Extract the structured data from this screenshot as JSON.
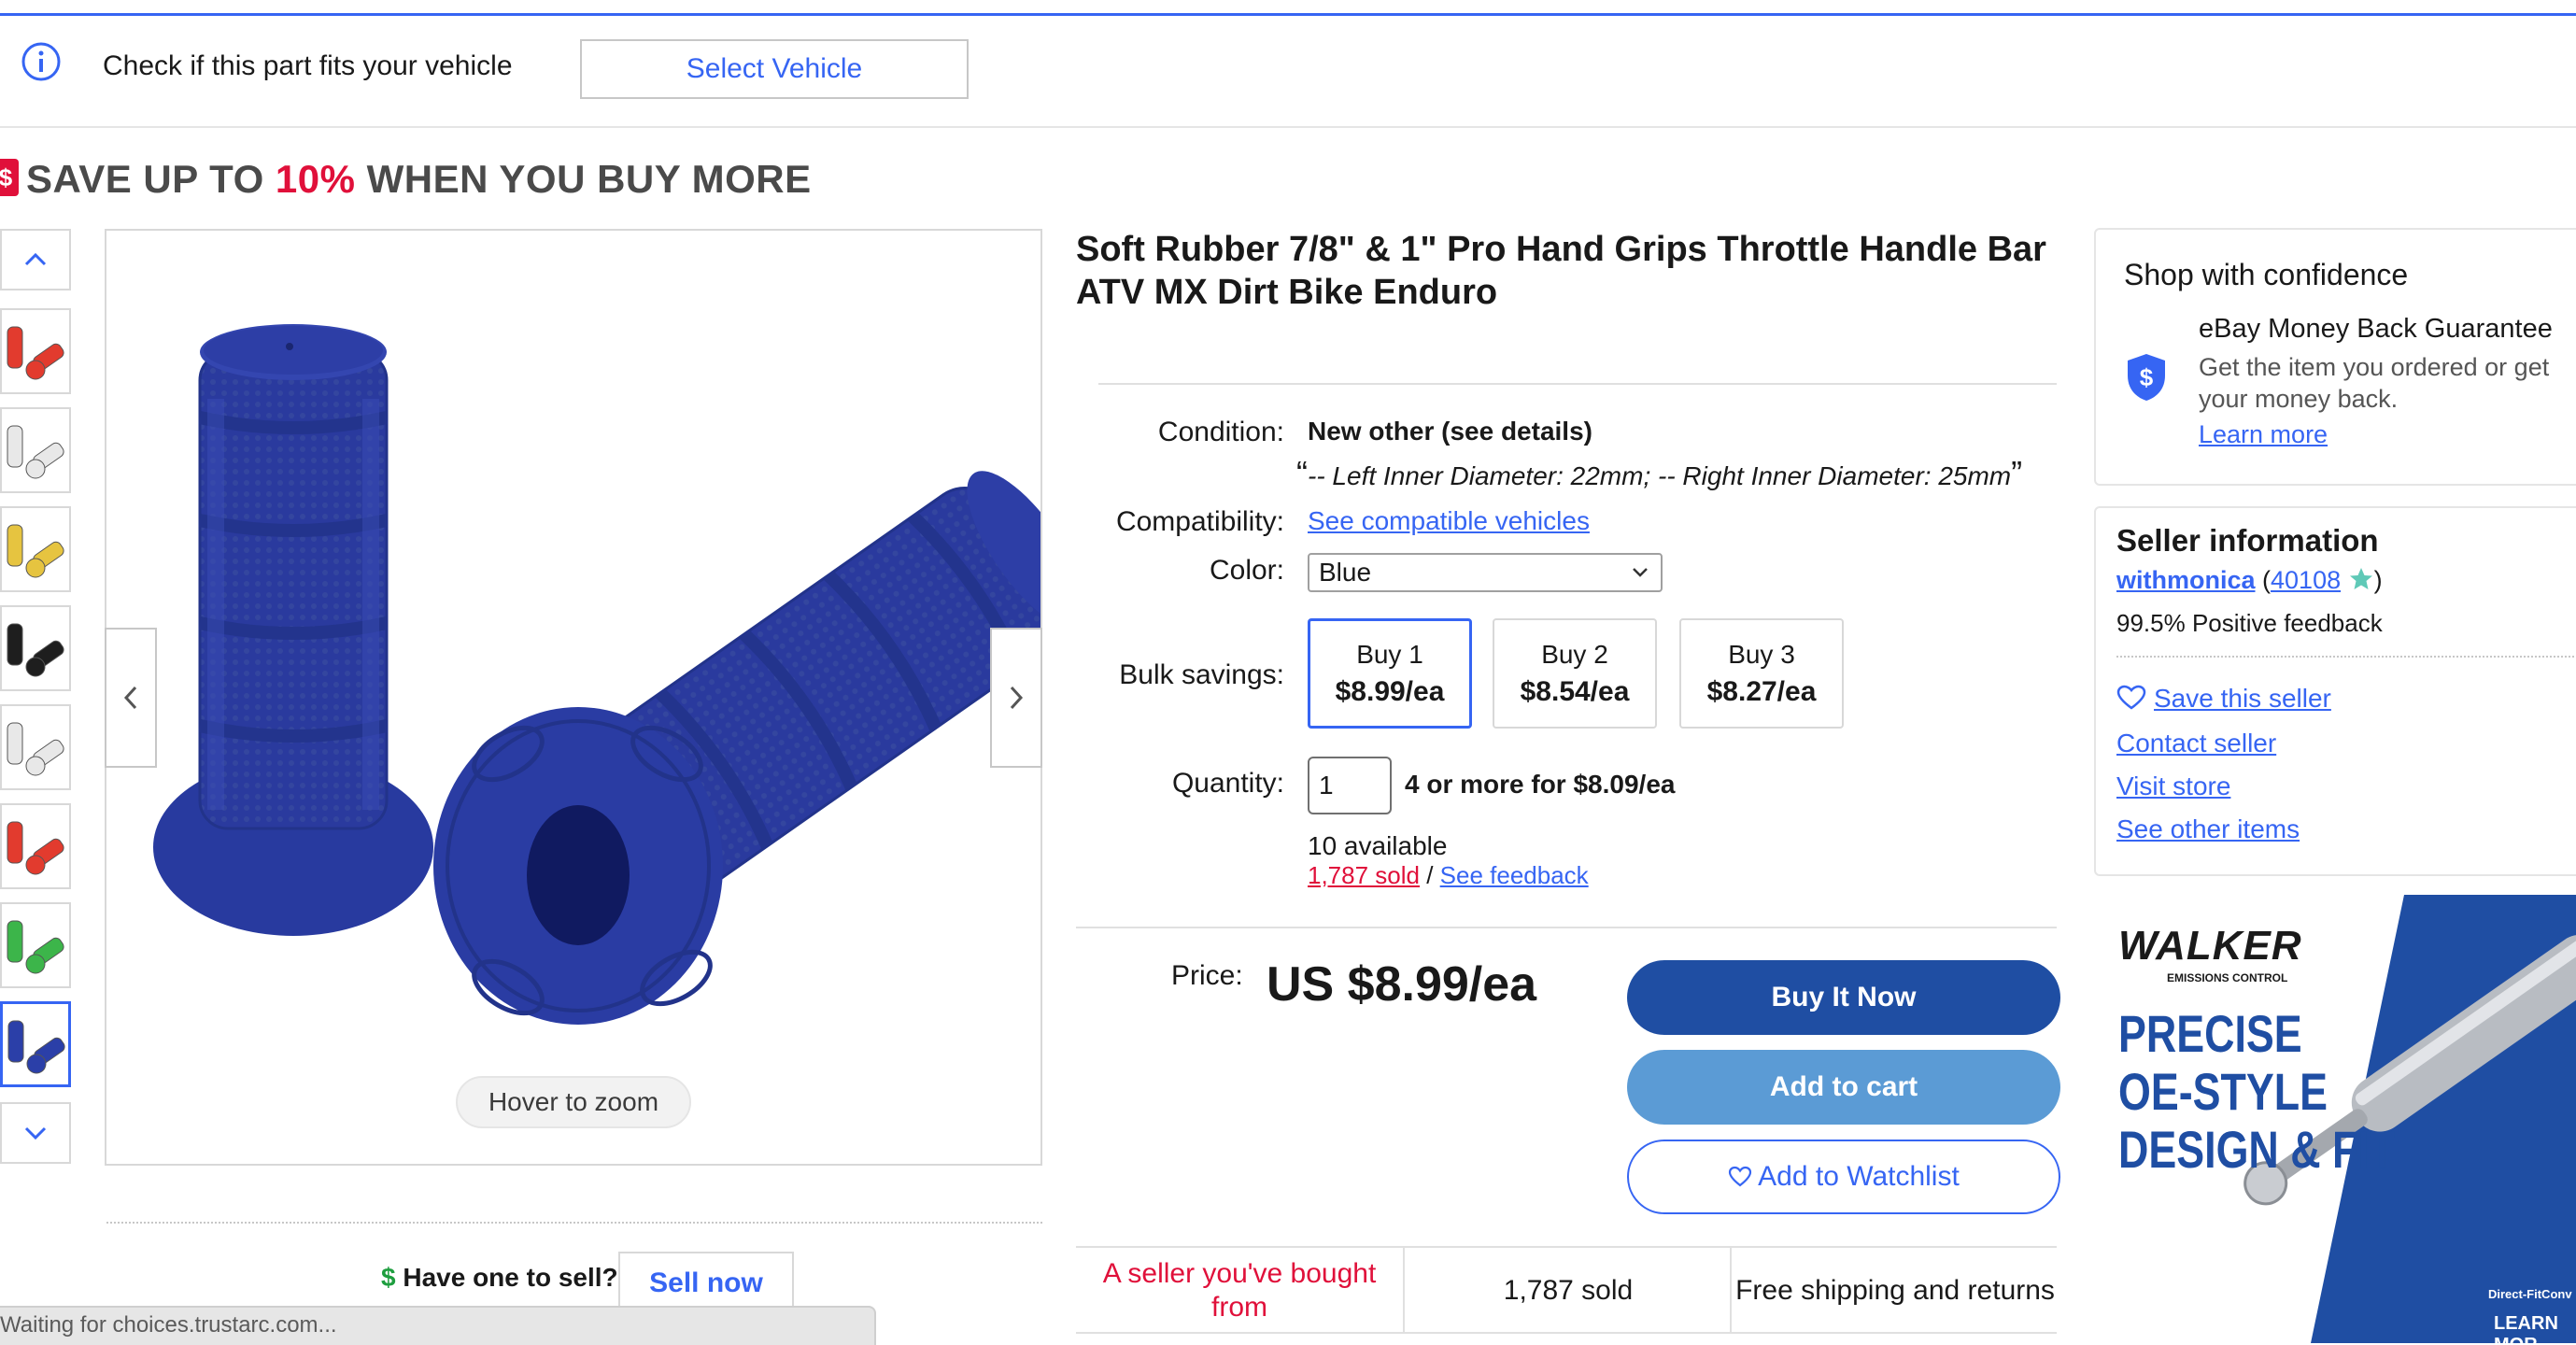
{
  "fitment": {
    "text": "Check if this part fits your vehicle",
    "button": "Select Vehicle"
  },
  "banner": {
    "prefix": "SAVE UP TO ",
    "percent": "10%",
    "suffix": " WHEN YOU BUY MORE"
  },
  "gallery": {
    "hover_zoom": "Hover to zoom",
    "thumbnails": [
      "red",
      "white",
      "yellow",
      "black",
      "white",
      "red",
      "green",
      "blue"
    ],
    "selected_thumbnail": 7
  },
  "sell": {
    "text": "Have one to sell?",
    "dollar": "$",
    "button": "Sell now"
  },
  "status_bar": "Waiting for choices.trustarc.com...",
  "listing": {
    "title": "Soft Rubber 7/8\" & 1\" Pro Hand Grips Throttle Handle Bar ATV MX Dirt Bike Enduro",
    "condition_label": "Condition:",
    "condition_value": "New other (see details)",
    "condition_note": "-- Left Inner Diameter: 22mm; -- Right Inner Diameter: 25mm",
    "compat_label": "Compatibility:",
    "compat_link": "See compatible vehicles",
    "color_label": "Color:",
    "color_value": "Blue",
    "bulk_label": "Bulk savings:",
    "bulk": [
      {
        "qty": "Buy 1",
        "price": "$8.99/ea"
      },
      {
        "qty": "Buy 2",
        "price": "$8.54/ea"
      },
      {
        "qty": "Buy 3",
        "price": "$8.27/ea"
      }
    ],
    "quantity_label": "Quantity:",
    "quantity_value": "1",
    "quantity_deal": "4 or more for $8.09/ea",
    "available": "10 available",
    "sold_link": "1,787 sold",
    "slash": " / ",
    "feedback_link": "See feedback",
    "price_label": "Price:",
    "price_value": "US $8.99/ea",
    "buy_now": "Buy It Now",
    "add_to_cart": "Add to cart",
    "watchlist": "Add to Watchlist",
    "badges": [
      "A seller you've bought from",
      "1,787 sold",
      "Free shipping and returns"
    ]
  },
  "confidence": {
    "title": "Shop with confidence",
    "guarantee_title": "eBay Money Back Guarantee",
    "guarantee_text": "Get the item you ordered or get your money back.",
    "learn_more": "Learn more"
  },
  "seller": {
    "title": "Seller information",
    "name": "withmonica",
    "score": "40108",
    "feedback": "99.5% Positive feedback",
    "save_seller": "Save this seller",
    "contact": "Contact seller",
    "visit_store": "Visit store",
    "other_items": "See other items"
  },
  "ad": {
    "brand": "WALKER",
    "brand_sub": "EMISSIONS CONTROL",
    "line1": "PRECISE",
    "line2": "OE-STYLE",
    "line3": "DESIGN & FIT",
    "small": "Direct-FitConv",
    "cta": "LEARN MOR"
  },
  "colors": {
    "accent": "#3665f3",
    "buy_now": "#1f4ea3",
    "add_to_cart": "#5b9bd5",
    "sale_red": "#e0103a",
    "product_blue": "#2b3fa8"
  }
}
